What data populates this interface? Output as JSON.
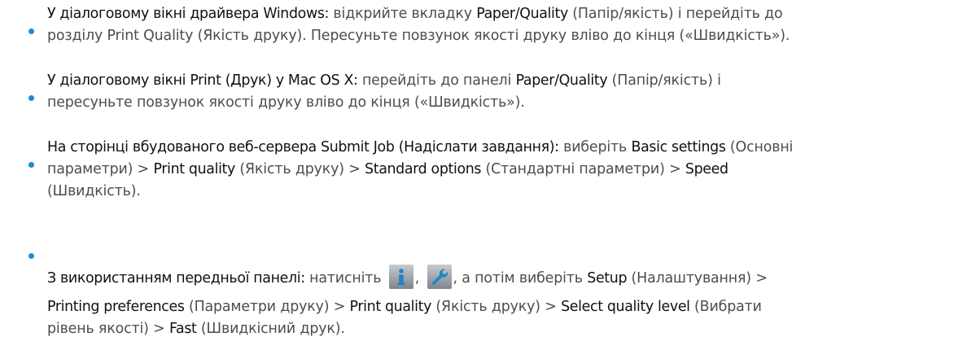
{
  "items": [
    {
      "lines": [
        [
          {
            "t": "У діалоговому вікні драйвера Windows:",
            "b": true
          },
          {
            "t": " відкрийте вкладку "
          },
          {
            "t": "Paper/Quality",
            "b": true
          },
          {
            "t": " (Папір/якість) і перейдіть до"
          }
        ],
        [
          {
            "t": "розділу Print Quality (Якість друку). Пересуньте повзунок якості друку вліво до кінця («Швидкість»)."
          }
        ]
      ]
    },
    {
      "lines": [
        [
          {
            "t": "У діалоговому вікні Print (Друк) у Mac OS X:",
            "b": true
          },
          {
            "t": " перейдіть до панелі "
          },
          {
            "t": "Paper/Quality",
            "b": true
          },
          {
            "t": " (Папір/якість) і"
          }
        ],
        [
          {
            "t": "пересуньте повзунок якості друку вліво до кінця («Швидкість»)."
          }
        ]
      ]
    },
    {
      "lines": [
        [
          {
            "t": "На сторінці вбудованого веб-сервера Submit Job (Надіслати завдання):",
            "b": true
          },
          {
            "t": " виберіть "
          },
          {
            "t": "Basic settings",
            "b": true
          },
          {
            "t": " (Основні"
          }
        ],
        [
          {
            "t": "параметри) > "
          },
          {
            "t": "Print quality",
            "b": true
          },
          {
            "t": " (Якість друку) > "
          },
          {
            "t": "Standard options",
            "b": true
          },
          {
            "t": " (Стандартні параметри) > "
          },
          {
            "t": "Speed",
            "b": true
          }
        ],
        [
          {
            "t": "(Швидкість)."
          }
        ]
      ]
    },
    {
      "lines": [
        [
          {
            "t": "З використанням передньої панелі:",
            "b": true
          },
          {
            "t": " натисніть "
          },
          {
            "icon": "info-icon"
          },
          {
            "t": ", "
          },
          {
            "icon": "wrench-icon"
          },
          {
            "t": ", а потім виберіть "
          },
          {
            "t": "Setup",
            "b": true
          },
          {
            "t": " (Налаштування) >"
          }
        ],
        [
          {
            "t": "Printing preferences",
            "b": true
          },
          {
            "t": " (Параметри друку) > "
          },
          {
            "t": "Print quality",
            "b": true
          },
          {
            "t": " (Якість друку) > "
          },
          {
            "t": "Select quality level",
            "b": true
          },
          {
            "t": " (Вибрати"
          }
        ],
        [
          {
            "t": "рівень якості) > "
          },
          {
            "t": "Fast",
            "b": true
          },
          {
            "t": " (Швидкісний друк)."
          }
        ]
      ]
    }
  ],
  "colors": {
    "bullet": "#1a8ad5",
    "text": "#4d4d4d",
    "bold_text": "#111111",
    "info_icon": "#1b86c9"
  }
}
